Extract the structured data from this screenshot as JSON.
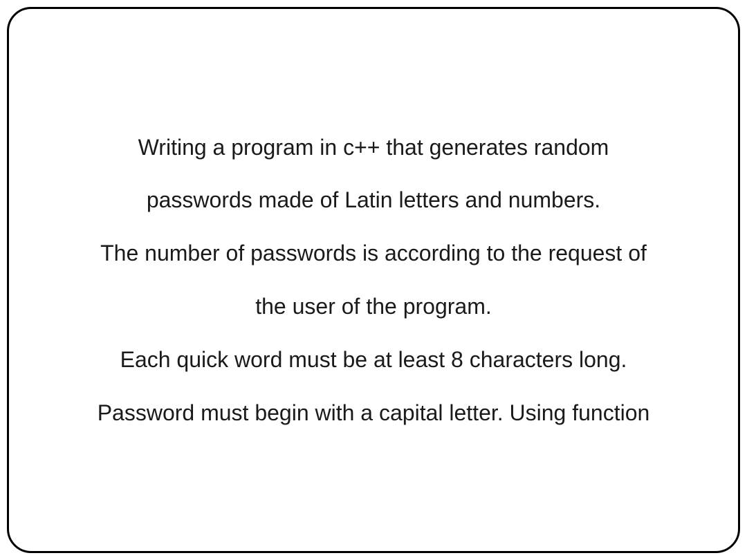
{
  "content": {
    "line1": "Writing a program in c++  that generates random",
    "line2": "passwords made of Latin letters and numbers.",
    "line3": "The number of passwords is according to the request of",
    "line4": "the user of the program.",
    "line5": "Each quick word must be at least 8 characters long.",
    "line6": "Password must begin with a capital letter.  Using function"
  }
}
